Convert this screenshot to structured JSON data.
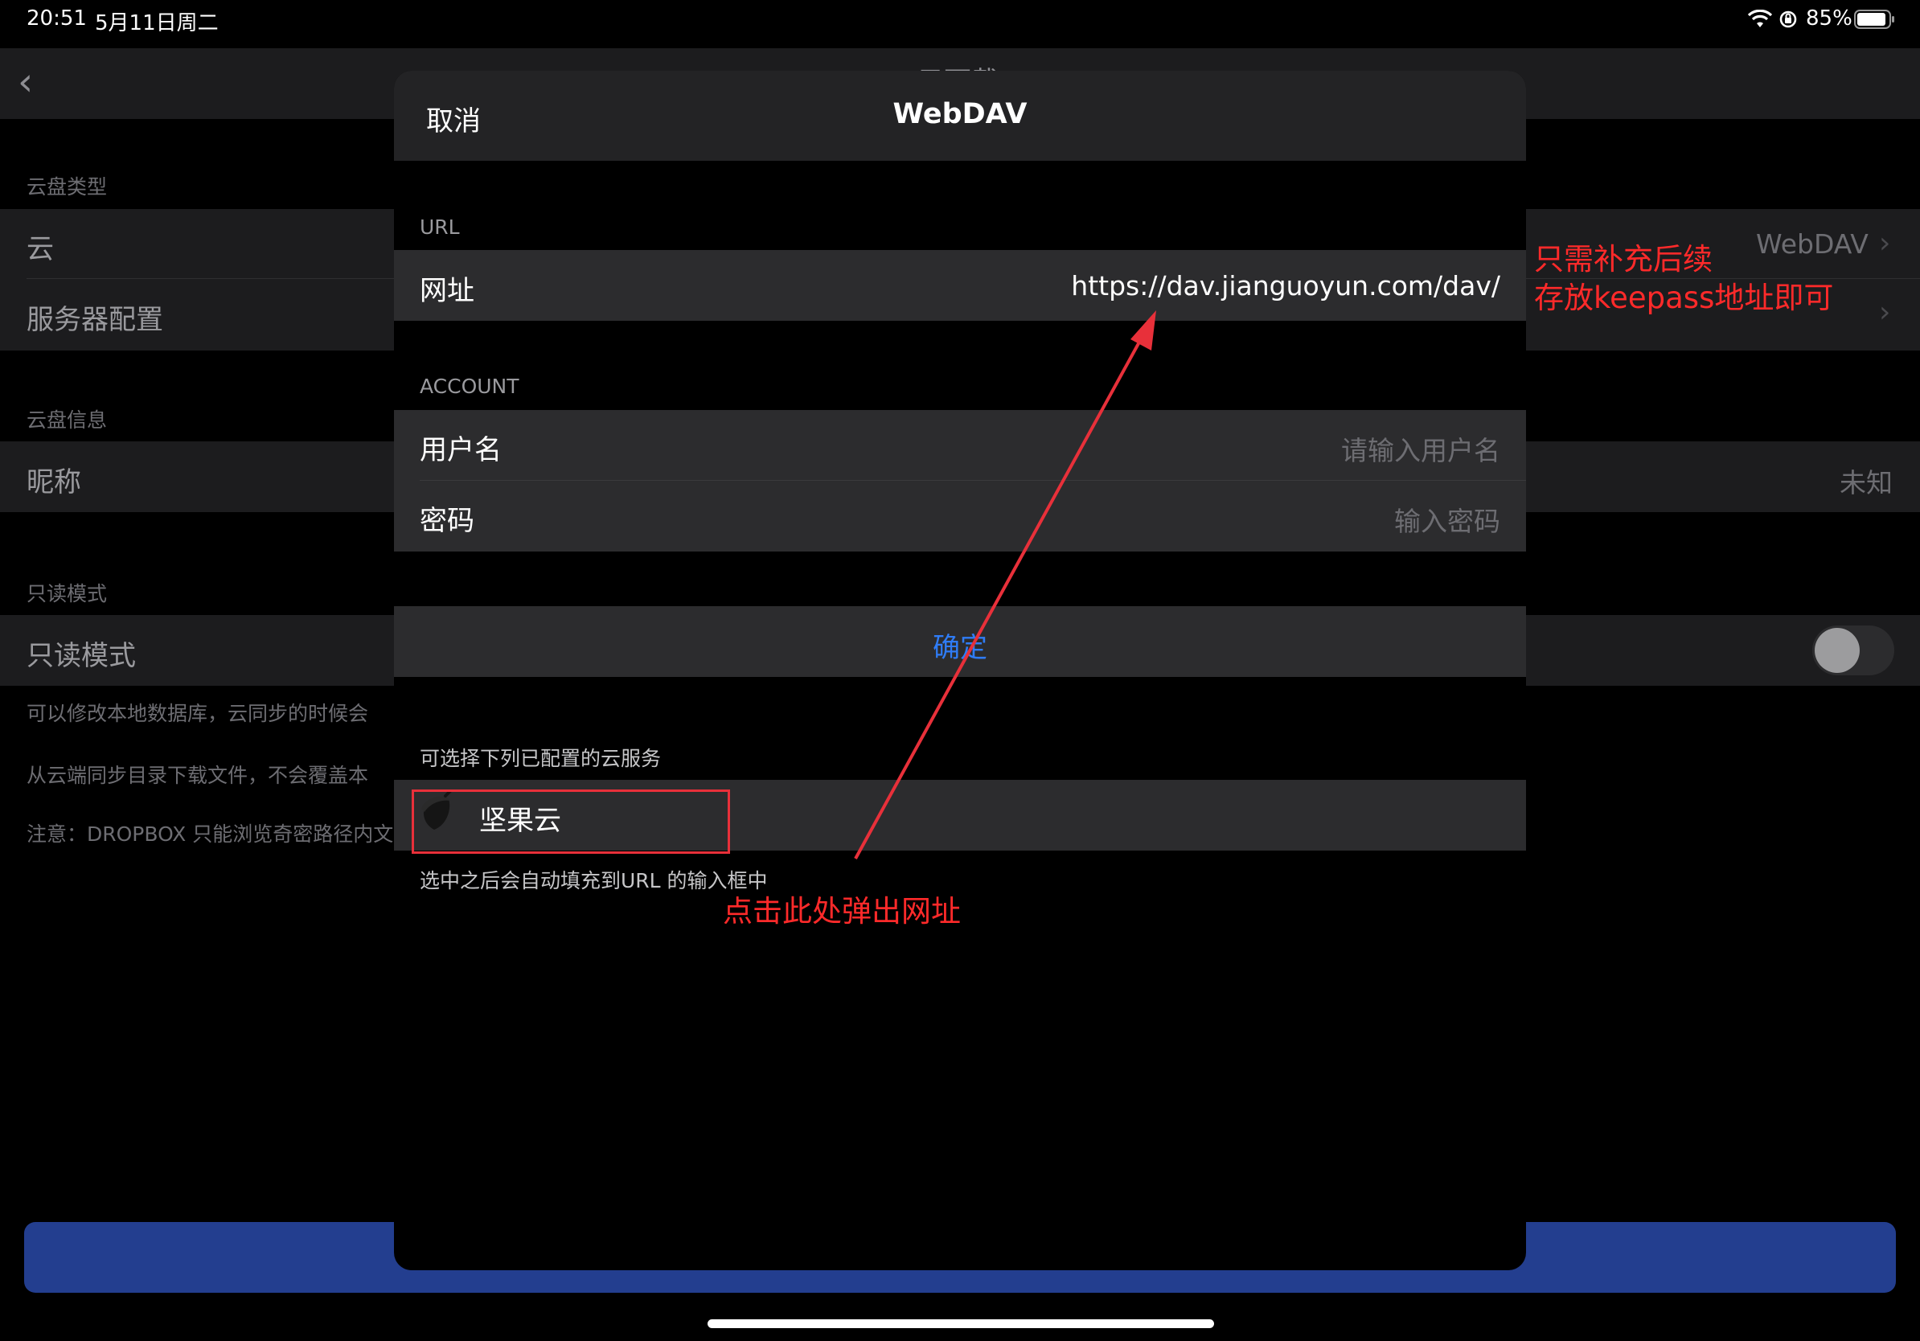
{
  "status_bar": {
    "time": "20:51",
    "date": "5月11日周二",
    "battery": "85%",
    "icons": [
      "wifi-icon",
      "orientation-lock-icon",
      "battery-icon"
    ]
  },
  "background": {
    "nav_title": "云下载",
    "sections": [
      {
        "header": "云盘类型",
        "rows": [
          {
            "label": "云",
            "value": "WebDAV"
          },
          {
            "label": "服务器配置",
            "value": ""
          }
        ]
      },
      {
        "header": "云盘信息",
        "rows": [
          {
            "label": "昵称",
            "value": "未知"
          }
        ]
      },
      {
        "header": "只读模式",
        "rows": [
          {
            "label": "只读模式",
            "value": ""
          }
        ]
      }
    ],
    "footer_lines": [
      "可以修改本地数据库，云同步的时候会",
      "从云端同步目录下载文件，不会覆盖本",
      "注意：DROPBOX 只能浏览奇密路径内文"
    ]
  },
  "modal": {
    "cancel_label": "取消",
    "title": "WebDAV",
    "url_header": "URL",
    "url_label": "网址",
    "url_value": "https://dav.jianguoyun.com/dav/",
    "account_header": "ACCOUNT",
    "username_label": "用户名",
    "username_placeholder": "请输入用户名",
    "password_label": "密码",
    "password_placeholder": "输入密码",
    "confirm_label": "确定",
    "services_header": "可选择下列已配置的云服务",
    "service_name": "坚果云",
    "services_footer": "选中之后会自动填充到URL 的输入框中"
  },
  "annotations": {
    "top_right_line1": "只需补充后续",
    "top_right_line2": "存放keepass地址即可",
    "bottom": "点击此处弹出网址",
    "color": "#ff2a2a"
  },
  "colors": {
    "accent": "#2f7cf6",
    "bottom_button": "#233e8f",
    "annotation": "#ff2a2a"
  }
}
